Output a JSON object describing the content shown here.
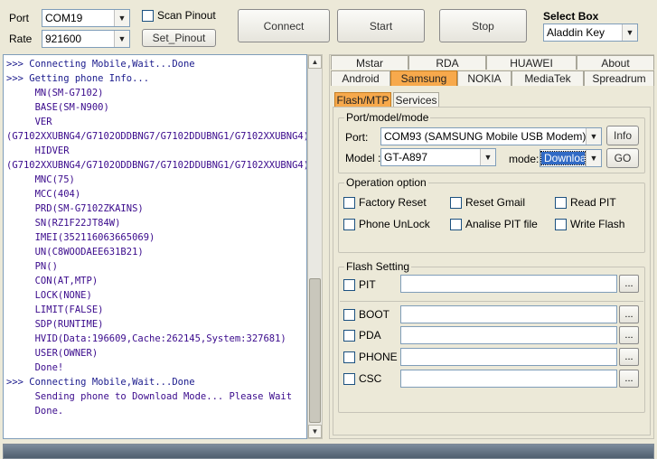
{
  "toolbar": {
    "port_label": "Port",
    "port_value": "COM19",
    "rate_label": "Rate",
    "rate_value": "921600",
    "scan_pinout_label": "Scan Pinout",
    "set_pinout_label": "Set_Pinout",
    "connect_label": "Connect",
    "start_label": "Start",
    "stop_label": "Stop",
    "select_box_label": "Select Box",
    "select_box_value": "Aladdin Key"
  },
  "log": {
    "lines": [
      {
        "text": ">>> Connecting Mobile,Wait...Done",
        "style": "blue"
      },
      {
        "text": ">>> Getting phone Info...",
        "style": "blue"
      },
      {
        "text": "     MN(SM-G7102)",
        "style": ""
      },
      {
        "text": "     BASE(SM-N900)",
        "style": ""
      },
      {
        "text": "     VER",
        "style": ""
      },
      {
        "text": "(G7102XXUBNG4/G7102ODDBNG7/G7102DDUBNG1/G7102XXUBNG4)",
        "style": ""
      },
      {
        "text": "     HIDVER",
        "style": ""
      },
      {
        "text": "(G7102XXUBNG4/G7102ODDBNG7/G7102DDUBNG1/G7102XXUBNG4)",
        "style": ""
      },
      {
        "text": "     MNC(75)",
        "style": ""
      },
      {
        "text": "     MCC(404)",
        "style": ""
      },
      {
        "text": "     PRD(SM-G7102ZKAINS)",
        "style": ""
      },
      {
        "text": "     SN(RZ1F22JT84W)",
        "style": ""
      },
      {
        "text": "     IMEI(352116063665069)",
        "style": ""
      },
      {
        "text": "     UN(C8WOODAEE631B21)",
        "style": ""
      },
      {
        "text": "     PN()",
        "style": ""
      },
      {
        "text": "     CON(AT,MTP)",
        "style": ""
      },
      {
        "text": "     LOCK(NONE)",
        "style": ""
      },
      {
        "text": "     LIMIT(FALSE)",
        "style": ""
      },
      {
        "text": "     SDP(RUNTIME)",
        "style": ""
      },
      {
        "text": "     HVID(Data:196609,Cache:262145,System:327681)",
        "style": ""
      },
      {
        "text": "     USER(OWNER)",
        "style": ""
      },
      {
        "text": "     Done!",
        "style": ""
      },
      {
        "text": ">>> Connecting Mobile,Wait...Done",
        "style": "blue"
      },
      {
        "text": "     Sending phone to Download Mode... Please Wait",
        "style": ""
      },
      {
        "text": "     Done.",
        "style": ""
      }
    ]
  },
  "tabs_row1": [
    "Mstar",
    "RDA",
    "HUAWEI",
    "About"
  ],
  "tabs_row2": [
    "Android",
    "Samsung",
    "NOKIA",
    "MediaTek",
    "Spreadrum"
  ],
  "subtabs": [
    "Flash/MTP",
    "Services"
  ],
  "port_group": {
    "title": "Port/model/mode",
    "port_label": "Port:",
    "port_value": "COM93 (SAMSUNG Mobile USB Modem)",
    "info_label": "Info",
    "model_label": "Model :",
    "model_value": "GT-A897",
    "mode_label": "mode:",
    "mode_value": "Downloac",
    "go_label": "GO"
  },
  "operation_group": {
    "title": "Operation option",
    "options": [
      "Factory Reset",
      "Reset Gmail",
      "Read PIT",
      "Phone UnLock",
      "Analise PIT file",
      "Write Flash"
    ]
  },
  "flash_group": {
    "title": "Flash Setting",
    "pit_label": "PIT",
    "files": [
      "BOOT",
      "PDA",
      "PHONE",
      "CSC"
    ],
    "browse_label": "..."
  },
  "colors": {
    "active_tab": "#f7a94c",
    "log_text": "#3a0a8c",
    "progress_bar": "#5a6b7d"
  }
}
